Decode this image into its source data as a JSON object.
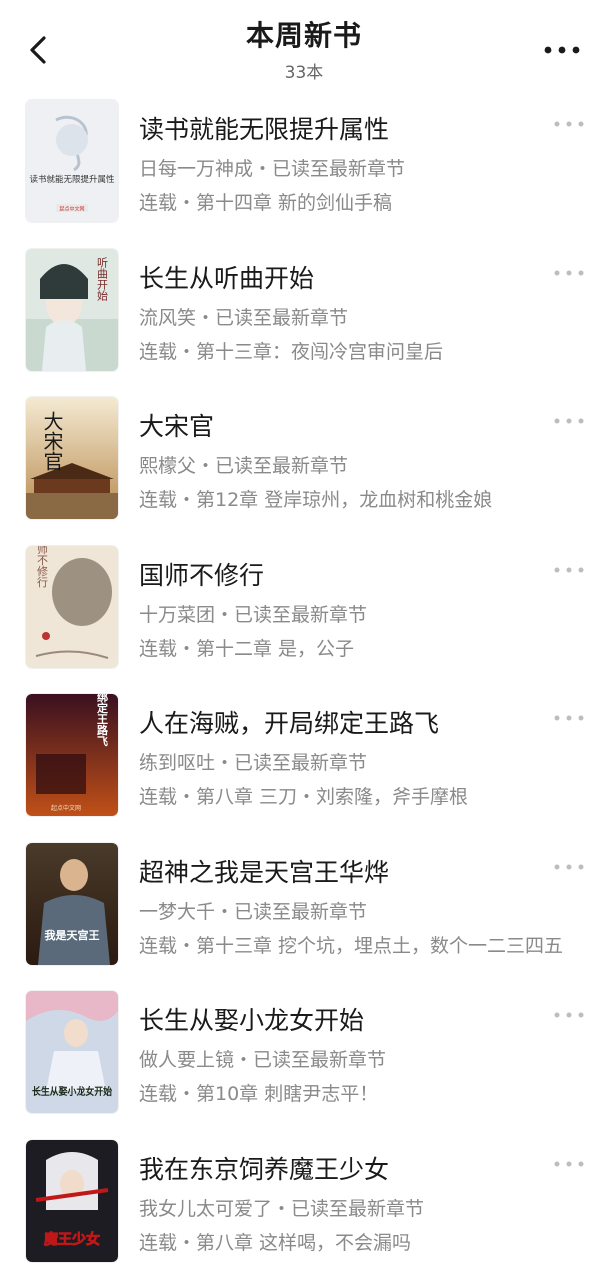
{
  "header": {
    "title": "本周新书",
    "count": "33本"
  },
  "icons": {
    "back": "chevron-left-icon",
    "more": "more-horizontal-icon"
  },
  "books": [
    {
      "title": "读书就能无限提升属性",
      "meta": "日每一万神成・已读至最新章节",
      "chapter": "连载・第十四章 新的剑仙手稿",
      "cover_text": "读书就能无限提升属性",
      "cover_publisher": "起点中文网"
    },
    {
      "title": "长生从听曲开始",
      "meta": "流风笑・已读至最新章节",
      "chapter": "连载・第十三章：夜闯冷宫审问皇后",
      "cover_text": "听曲开始"
    },
    {
      "title": "大宋官",
      "meta": "熙檬父・已读至最新章节",
      "chapter": "连载・第12章 登岸琼州，龙血树和桃金娘",
      "cover_text": "大宋官"
    },
    {
      "title": "国师不修行",
      "meta": "十万菜团・已读至最新章节",
      "chapter": "连载・第十二章 是，公子",
      "cover_text": "国师不修行"
    },
    {
      "title": "人在海贼，开局绑定王路飞",
      "meta": "练到呕吐・已读至最新章节",
      "chapter": "连载・第八章 三刀・刘索隆，斧手摩根",
      "cover_text": "开局绑定王路飞",
      "cover_publisher": "起点中文网"
    },
    {
      "title": "超神之我是天宫王华烨",
      "meta": "一梦大千・已读至最新章节",
      "chapter": "连载・第十三章 挖个坑，埋点土，数个一二三四五",
      "cover_text": "我是天宫王"
    },
    {
      "title": "长生从娶小龙女开始",
      "meta": "做人要上镜・已读至最新章节",
      "chapter": "连载・第10章 刺瞎尹志平！",
      "cover_text": "长生从娶小龙女开始"
    },
    {
      "title": "我在东京饲养魔王少女",
      "meta": "我女儿太可爱了・已读至最新章节",
      "chapter": "连载・第八章 这样喝，不会漏吗",
      "cover_text": "魔王少女"
    }
  ]
}
